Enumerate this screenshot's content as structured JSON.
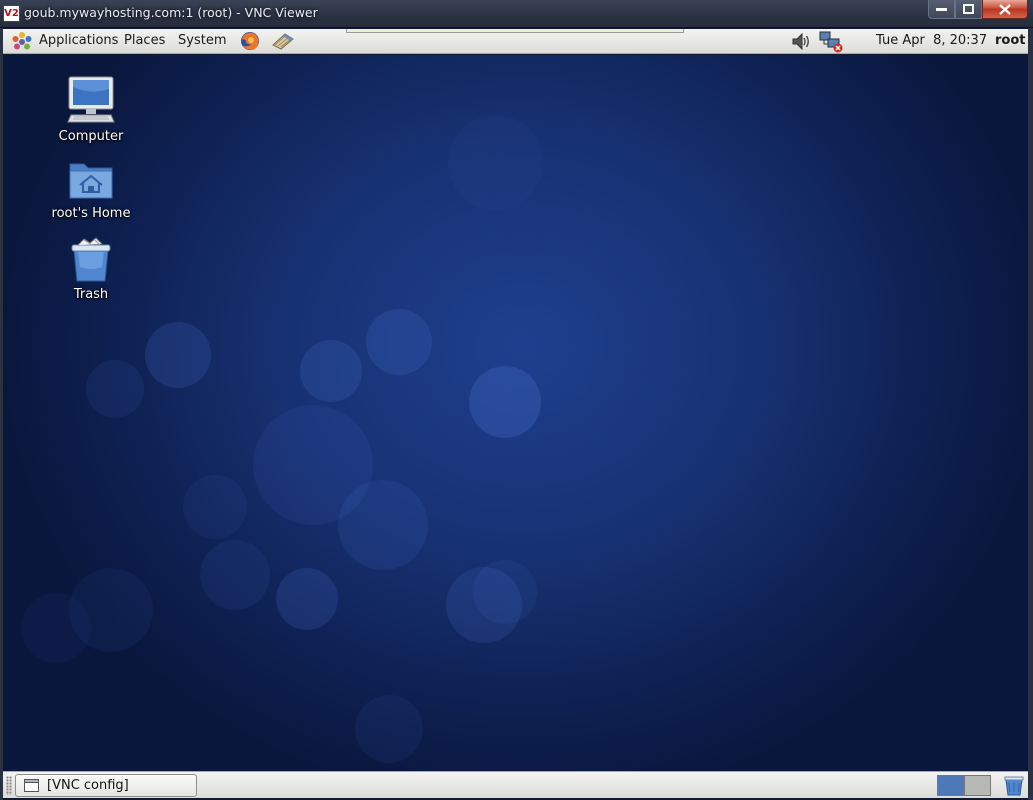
{
  "window": {
    "app_icon_text": "V2",
    "title": "goub.mywayhosting.com:1 (root) - VNC Viewer",
    "buttons": [
      "minimize-icon",
      "maximize-icon",
      "close-icon"
    ]
  },
  "top_panel": {
    "menus": [
      "Applications",
      "Places",
      "System"
    ],
    "launchers": [
      "firefox-icon",
      "notes-icon"
    ],
    "clock": "Tue Apr  8, 20:37",
    "user": "root",
    "tray_icons": [
      "volume-icon",
      "network-disconnected-icon"
    ]
  },
  "desktop": {
    "icons": [
      {
        "label": "Computer",
        "icon": "computer-icon"
      },
      {
        "label": "root's Home",
        "icon": "home-folder-icon"
      },
      {
        "label": "Trash",
        "icon": "trash-icon"
      }
    ]
  },
  "bottom_panel": {
    "tasks": [
      {
        "label": "[VNC config]",
        "icon": "window-icon"
      }
    ],
    "workspace_colors": {
      "active": "#4d79b8",
      "inactive": "#b7b7b3"
    }
  },
  "colors": {
    "desktop_background": "#173273",
    "panel": "#e6e6e2",
    "titlebar": "#2a3142"
  }
}
